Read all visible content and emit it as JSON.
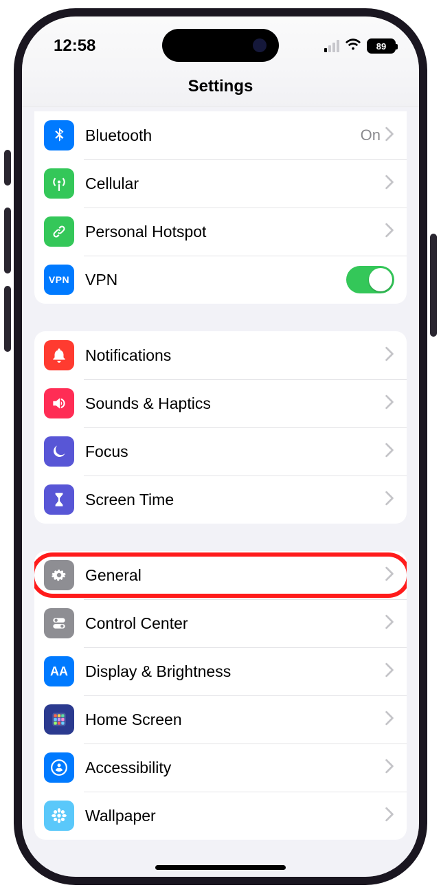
{
  "status": {
    "time": "12:58",
    "battery": "89"
  },
  "nav": {
    "title": "Settings"
  },
  "groups": [
    {
      "rows": [
        {
          "id": "bluetooth",
          "icon": "bluetooth",
          "color": "c-blue",
          "label": "Bluetooth",
          "value": "On",
          "accessory": "disclosure"
        },
        {
          "id": "cellular",
          "icon": "antenna",
          "color": "c-green",
          "label": "Cellular",
          "accessory": "disclosure"
        },
        {
          "id": "hotspot",
          "icon": "link",
          "color": "c-green",
          "label": "Personal Hotspot",
          "accessory": "disclosure"
        },
        {
          "id": "vpn",
          "icon": "vpn",
          "color": "c-blue2",
          "label": "VPN",
          "accessory": "toggle",
          "toggle": true
        }
      ]
    },
    {
      "rows": [
        {
          "id": "notifications",
          "icon": "bell",
          "color": "c-red",
          "label": "Notifications",
          "accessory": "disclosure"
        },
        {
          "id": "sounds",
          "icon": "speaker",
          "color": "c-pink",
          "label": "Sounds & Haptics",
          "accessory": "disclosure"
        },
        {
          "id": "focus",
          "icon": "moon",
          "color": "c-purple",
          "label": "Focus",
          "accessory": "disclosure"
        },
        {
          "id": "screentime",
          "icon": "hourglass",
          "color": "c-purple",
          "label": "Screen Time",
          "accessory": "disclosure"
        }
      ]
    },
    {
      "rows": [
        {
          "id": "general",
          "icon": "gear",
          "color": "c-gray",
          "label": "General",
          "accessory": "disclosure",
          "highlighted": true
        },
        {
          "id": "controlcenter",
          "icon": "switches",
          "color": "c-gray",
          "label": "Control Center",
          "accessory": "disclosure"
        },
        {
          "id": "display",
          "icon": "aa",
          "color": "c-blue",
          "label": "Display & Brightness",
          "accessory": "disclosure"
        },
        {
          "id": "homescreen",
          "icon": "grid",
          "color": "c-darkblue",
          "label": "Home Screen",
          "accessory": "disclosure"
        },
        {
          "id": "accessibility",
          "icon": "person",
          "color": "c-blue",
          "label": "Accessibility",
          "accessory": "disclosure"
        },
        {
          "id": "wallpaper",
          "icon": "flower",
          "color": "c-lightblue",
          "label": "Wallpaper",
          "accessory": "disclosure"
        }
      ]
    }
  ]
}
